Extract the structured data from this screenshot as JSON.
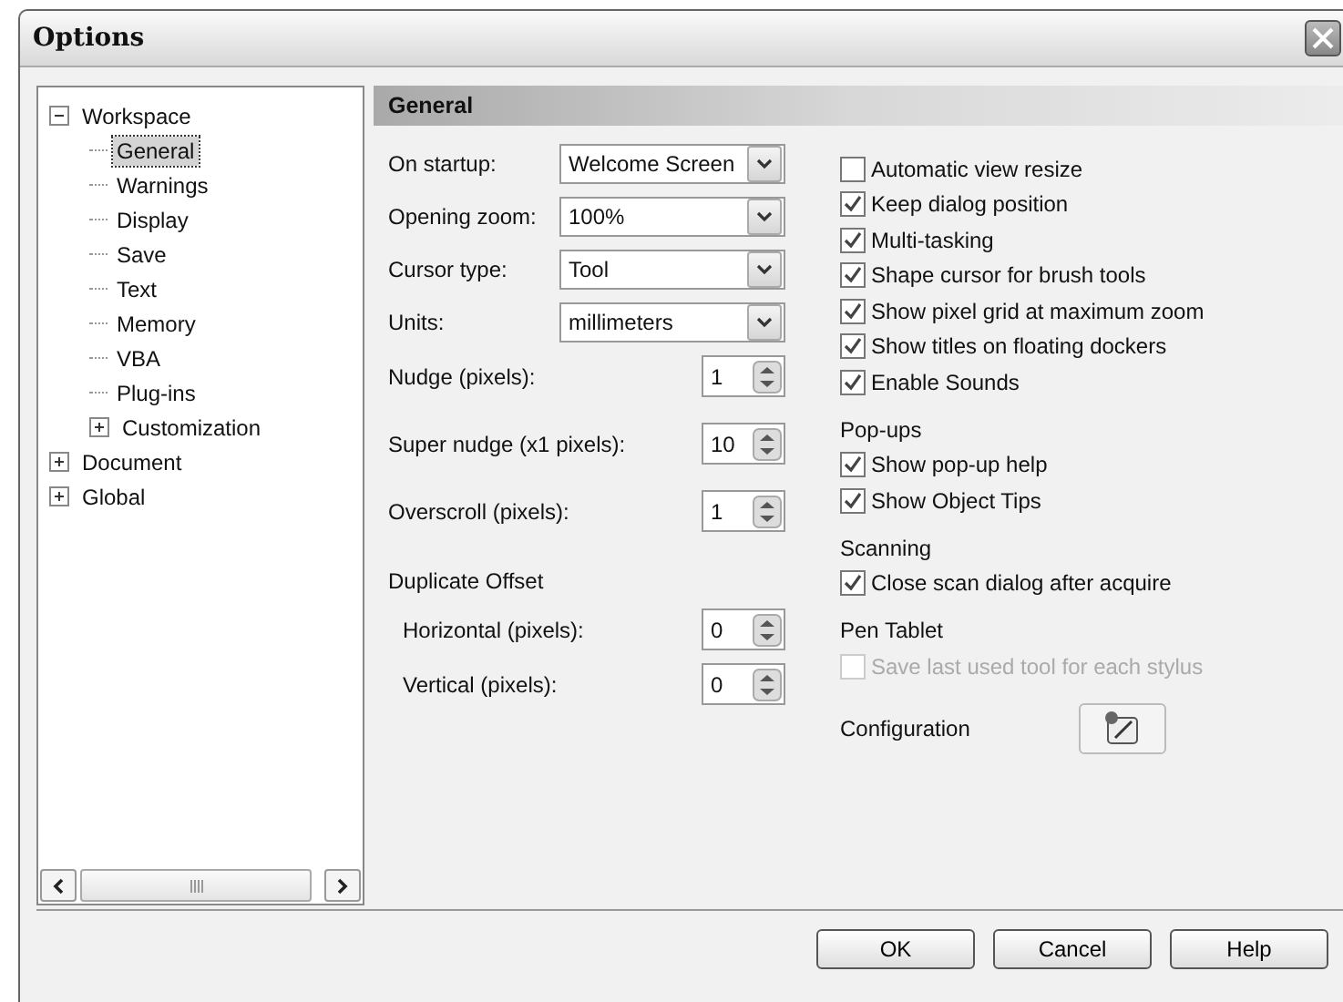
{
  "window": {
    "title": "Options"
  },
  "tree": [
    {
      "label": "Workspace",
      "expanded": true,
      "selected": false,
      "children": [
        {
          "label": "General",
          "selected": true
        },
        {
          "label": "Warnings",
          "selected": false
        },
        {
          "label": "Display",
          "selected": false
        },
        {
          "label": "Save",
          "selected": false
        },
        {
          "label": "Text",
          "selected": false
        },
        {
          "label": "Memory",
          "selected": false
        },
        {
          "label": "VBA",
          "selected": false
        },
        {
          "label": "Plug-ins",
          "selected": false
        },
        {
          "label": "Customization",
          "expanded": false,
          "selected": false
        }
      ]
    },
    {
      "label": "Document",
      "expanded": false,
      "selected": false
    },
    {
      "label": "Global",
      "expanded": false,
      "selected": false
    }
  ],
  "panel": {
    "title": "General",
    "left": [
      {
        "kind": "dropdown",
        "label": "On startup:",
        "value": "Welcome Screen"
      },
      {
        "kind": "dropdown",
        "label": "Opening zoom:",
        "value": "100%"
      },
      {
        "kind": "dropdown",
        "label": "Cursor type:",
        "value": "Tool"
      },
      {
        "kind": "dropdown",
        "label": "Units:",
        "value": "millimeters"
      },
      {
        "kind": "spin",
        "label": "Nudge (pixels):",
        "value": "1"
      },
      {
        "kind": "spin",
        "label": "Super nudge (x1 pixels):",
        "value": "10"
      },
      {
        "kind": "spin",
        "label": "Overscroll (pixels):",
        "value": "1"
      },
      {
        "kind": "group",
        "label": "Duplicate Offset",
        "children": [
          {
            "kind": "spin",
            "label": "Horizontal (pixels):",
            "value": "0"
          },
          {
            "kind": "spin",
            "label": "Vertical (pixels):",
            "value": "0"
          }
        ]
      }
    ],
    "right": [
      {
        "kind": "checkbox",
        "label": "Automatic view resize",
        "checked": false,
        "disabled": false
      },
      {
        "kind": "checkbox",
        "label": "Keep dialog position",
        "checked": true,
        "disabled": false
      },
      {
        "kind": "checkbox",
        "label": "Multi-tasking",
        "checked": true,
        "disabled": false
      },
      {
        "kind": "checkbox",
        "label": "Shape cursor for brush tools",
        "checked": true,
        "disabled": false
      },
      {
        "kind": "checkbox",
        "label": "Show pixel grid at maximum zoom",
        "checked": true,
        "disabled": false
      },
      {
        "kind": "checkbox",
        "label": "Show titles on floating dockers",
        "checked": true,
        "disabled": false
      },
      {
        "kind": "checkbox",
        "label": "Enable Sounds",
        "checked": true,
        "disabled": false
      },
      {
        "kind": "heading",
        "label": "Pop-ups"
      },
      {
        "kind": "checkbox",
        "label": "Show pop-up help",
        "checked": true,
        "disabled": false
      },
      {
        "kind": "checkbox",
        "label": "Show Object Tips",
        "checked": true,
        "disabled": false
      },
      {
        "kind": "heading",
        "label": "Scanning"
      },
      {
        "kind": "checkbox",
        "label": "Close scan dialog after acquire",
        "checked": true,
        "disabled": false
      },
      {
        "kind": "heading",
        "label": "Pen Tablet"
      },
      {
        "kind": "checkbox",
        "label": "Save last used tool for each stylus",
        "checked": false,
        "disabled": true
      },
      {
        "kind": "button",
        "label": "Configuration"
      }
    ]
  },
  "buttons": [
    "OK",
    "Cancel",
    "Help"
  ]
}
